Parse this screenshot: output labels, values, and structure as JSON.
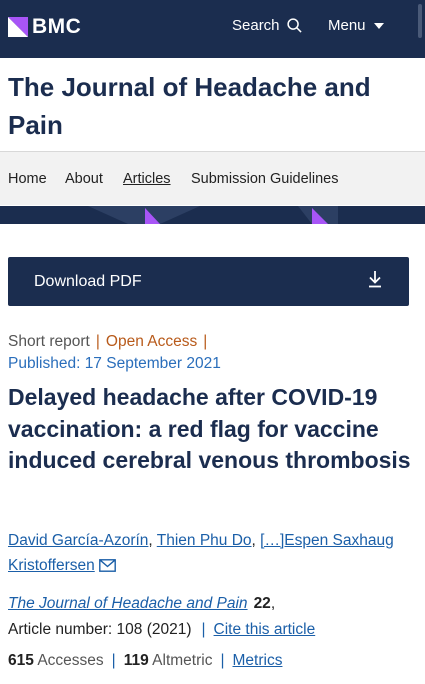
{
  "header": {
    "logo_text": "BMC",
    "search_label": "Search",
    "menu_label": "Menu"
  },
  "journal": {
    "title": "The Journal of Headache and Pain"
  },
  "nav": {
    "items": [
      {
        "label": "Home"
      },
      {
        "label": "About"
      },
      {
        "label": "Articles"
      },
      {
        "label": "Submission Guidelines"
      }
    ]
  },
  "download": {
    "label": "Download PDF"
  },
  "article": {
    "type": "Short report",
    "access": "Open Access",
    "published": "Published: 17 September 2021",
    "title": "Delayed headache after COVID-19 vaccination: a red flag for vaccine induced cerebral venous thrombosis",
    "authors": {
      "first": "David García-Azorín",
      "second": "Thien Phu Do",
      "ellipsis_last": "[…]Espen Saxhaug Kristoffersen"
    },
    "citation": {
      "journal": "The Journal of Headache and Pain",
      "volume": "22",
      "article_number": "Article number: 108 (2021)",
      "cite_label": "Cite this article"
    },
    "metrics": {
      "accesses_count": "615",
      "accesses_label": "Accesses",
      "altmetric_count": "119",
      "altmetric_label": "Altmetric",
      "metrics_link": "Metrics"
    }
  },
  "colors": {
    "brand_navy": "#1b2d4f",
    "brand_purple": "#a855f7",
    "link_blue": "#1b5fa8",
    "open_access_orange": "#b85a1a"
  }
}
